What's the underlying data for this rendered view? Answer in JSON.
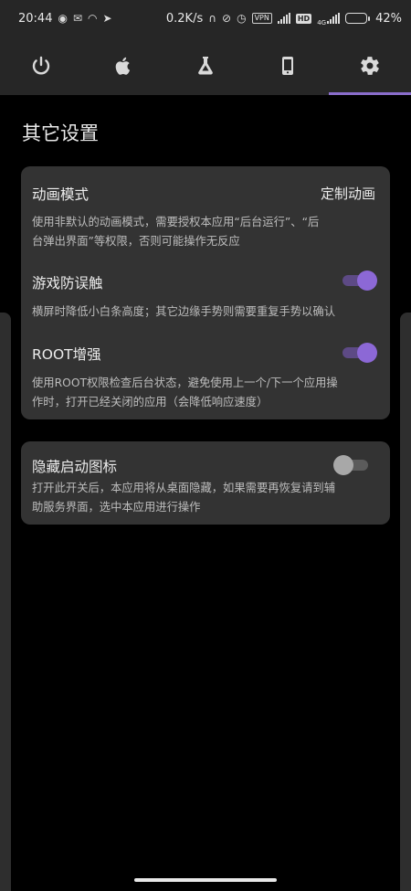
{
  "status_bar": {
    "time": "20:44",
    "net_speed": "0.2K/s",
    "vpn_label": "VPN",
    "hd_label": "HD",
    "network_label": "4G",
    "battery_percent_label": "42%",
    "battery_level": 0.42,
    "battery_color": "#f2a93b",
    "icons": [
      "netease-music-icon",
      "wechat-icon",
      "wifi-hotspot-icon",
      "send-icon",
      "headphones-icon",
      "alarm-off-icon",
      "alarm-icon",
      "signal-icon",
      "signal-icon"
    ]
  },
  "tabs": [
    {
      "name": "power-icon",
      "active": false
    },
    {
      "name": "apple-icon",
      "active": false
    },
    {
      "name": "flask-icon",
      "active": false
    },
    {
      "name": "phone-icon",
      "active": false
    },
    {
      "name": "gear-icon",
      "active": true
    }
  ],
  "accent_color": "#8a6dcc",
  "page": {
    "title": "其它设置"
  },
  "card1": {
    "animation": {
      "title": "动画模式",
      "value": "定制动画",
      "desc_line1": "使用非默认的动画模式，需要授权本应用“后台运行”、“后",
      "desc_line2": "台弹出界面”等权限，否则可能操作无反应"
    },
    "game_guard": {
      "title": "游戏防误触",
      "desc_line1": "横屏时降低小白条高度；其它边缘手势则需要重复手势以确认",
      "enabled": true
    },
    "root_boost": {
      "title": "ROOT增强",
      "desc_line1": "使用ROOT权限检查后台状态，避免使用上一个/下一个应用操",
      "desc_line2": "作时，打开已经关闭的应用（会降低响应速度）",
      "enabled": true
    }
  },
  "card2": {
    "hide_icon": {
      "title": "隐藏启动图标",
      "desc_line1": "打开此开关后，本应用将从桌面隐藏，如果需要再恢复请到辅",
      "desc_line2": "助服务界面，选中本应用进行操作",
      "enabled": false
    }
  }
}
